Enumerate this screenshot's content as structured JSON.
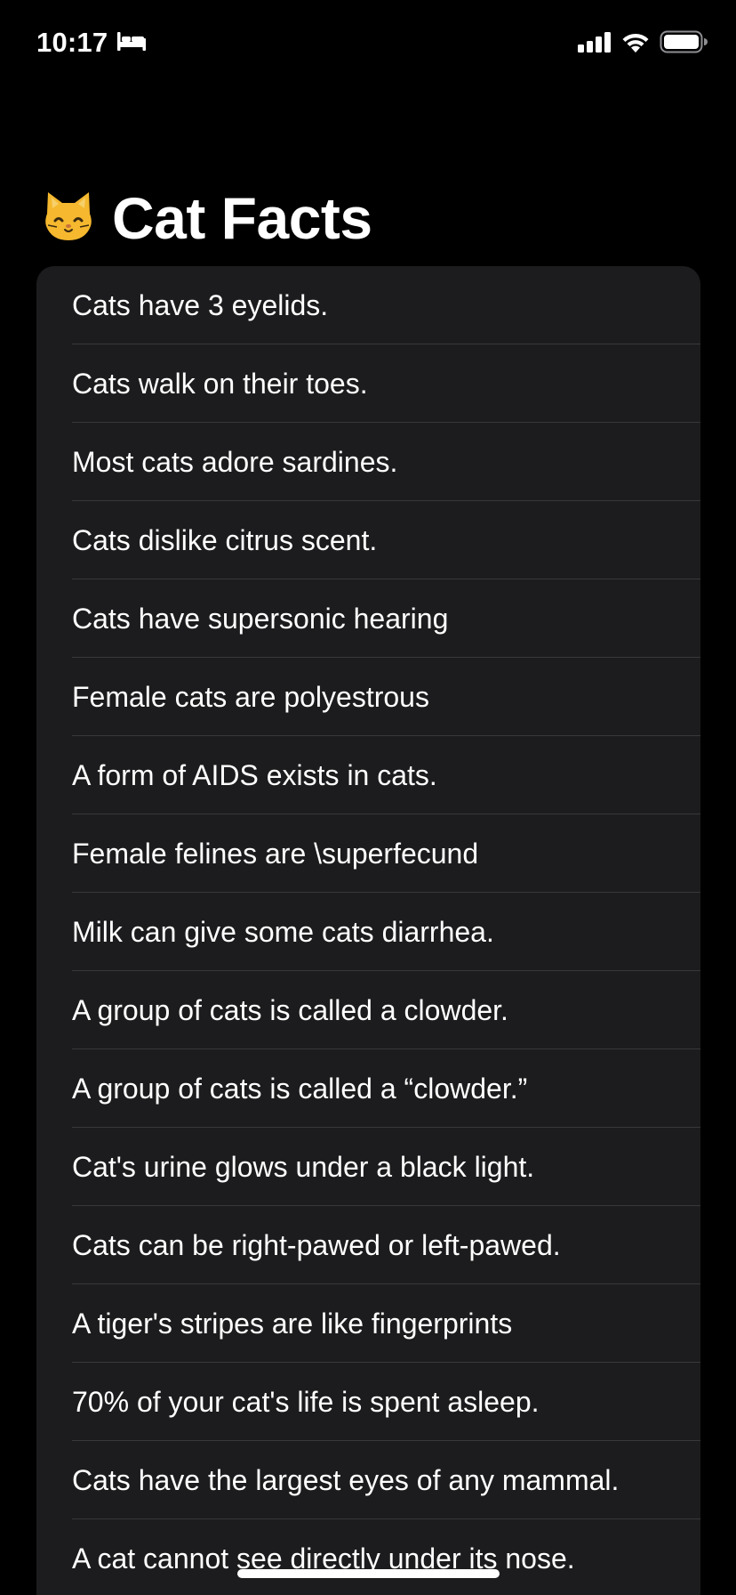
{
  "status_bar": {
    "time": "10:17",
    "focus_icon": "bed-icon",
    "signal_icon": "cellular-signal-icon",
    "wifi_icon": "wifi-icon",
    "battery_icon": "battery-icon"
  },
  "header": {
    "emoji": "🐱",
    "emoji_icon": "cat-face-icon",
    "title": "Cat Facts"
  },
  "facts": [
    "Cats have 3 eyelids.",
    "Cats walk on their toes.",
    "Most cats adore sardines.",
    "Cats dislike citrus scent.",
    "Cats have supersonic hearing",
    "Female cats are polyestrous",
    "A form of AIDS exists in cats.",
    "Female felines are \\superfecund",
    "Milk can give some cats diarrhea.",
    "A group of cats is called a clowder.",
    "A group of cats is called a “clowder.”",
    "Cat's urine glows under a black light.",
    "Cats can be right-pawed or left-pawed.",
    "A tiger's stripes are like fingerprints",
    "70% of your cat's life is spent asleep.",
    "Cats have the largest eyes of any mammal.",
    "A cat cannot see directly under its nose."
  ],
  "colors": {
    "background": "#000000",
    "card": "#1c1c1e",
    "separator": "#38383a",
    "text": "#ffffff",
    "cat_emoji": "#f5b82e"
  }
}
